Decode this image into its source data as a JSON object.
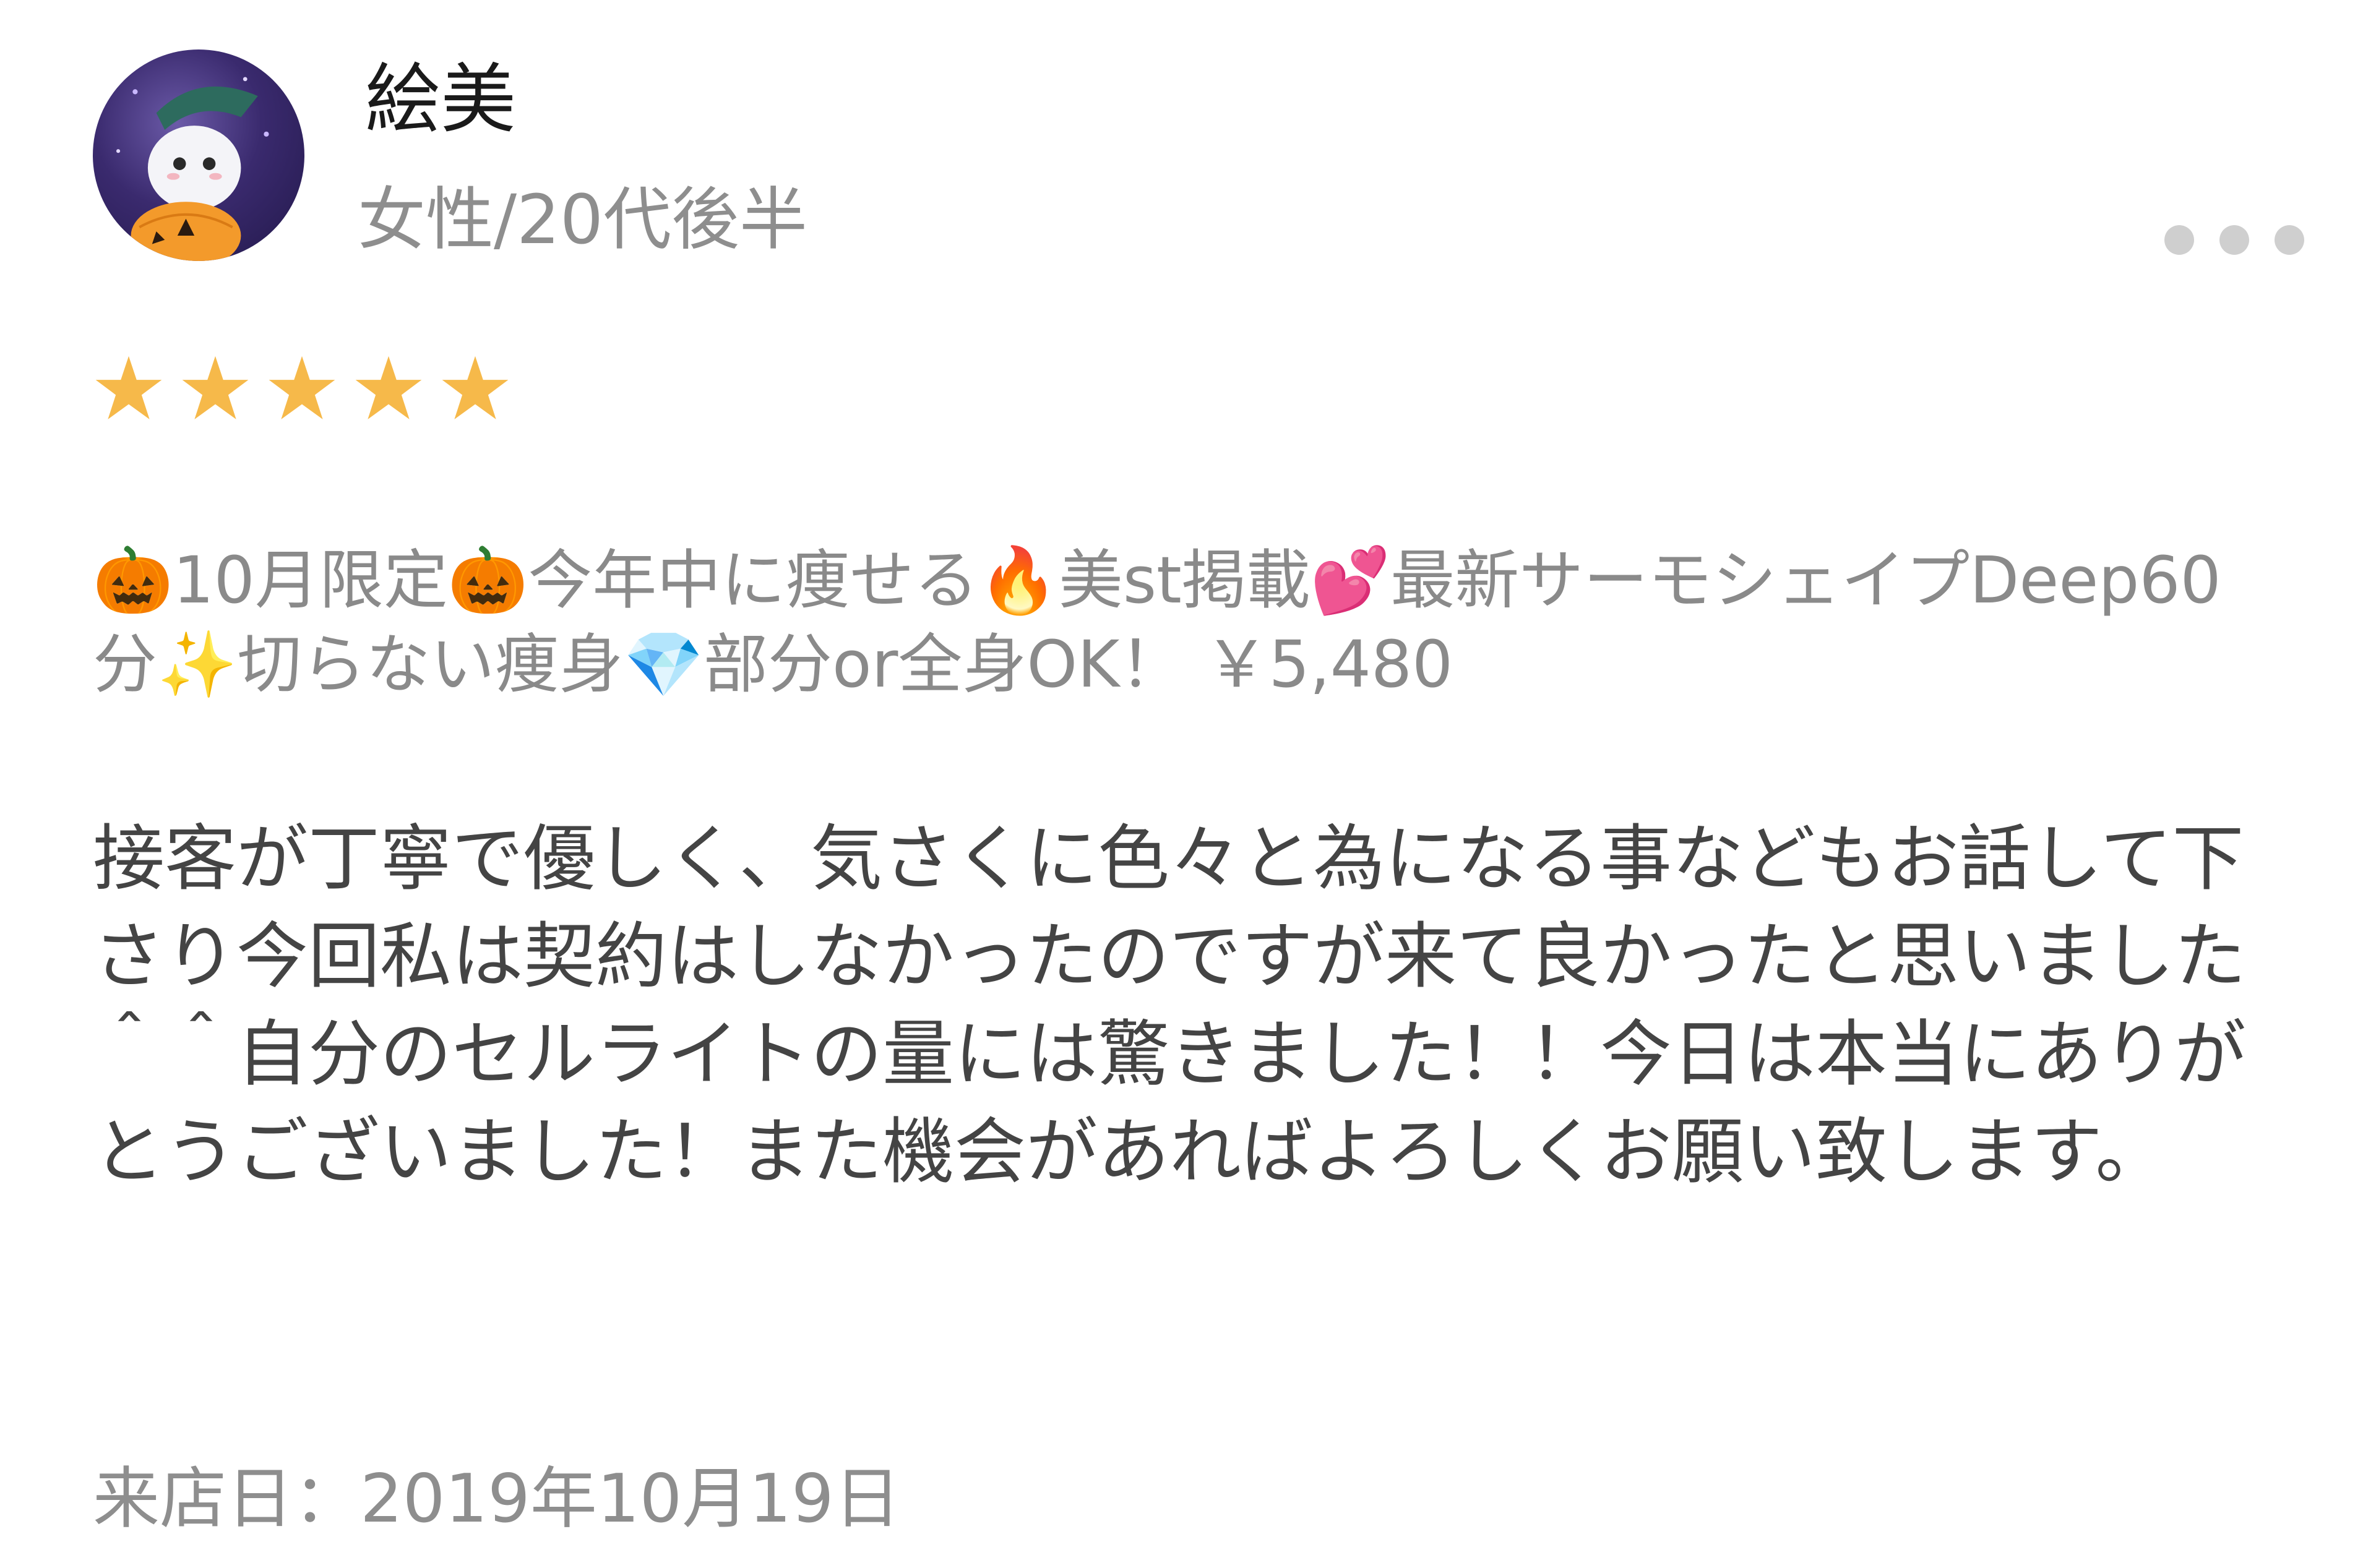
{
  "reviewer": {
    "name": "絵美",
    "demographic": "女性/20代後半",
    "avatar_icon": "ghost-pumpkin-avatar"
  },
  "rating": {
    "value": 5,
    "max": 5,
    "color": "#f6b94a"
  },
  "menu_title": "🎃10月限定🎃今年中に痩せる🔥美st掲載💕最新サーモシェイプDeep60分✨切らない痩身💎部分or全身OK！ ￥5,480",
  "review_text": "接客が丁寧で優しく、気さくに色々と為になる事などもお話して下さり今回私は契約はしなかったのですが来て良かったと思いました＾＾自分のセルライトの量には驚きました！！今日は本当にありがとうございました！また機会があればよろしくお願い致します。",
  "visit_date": "来店日：2019年10月19日",
  "more_icon": "more-dots-icon"
}
